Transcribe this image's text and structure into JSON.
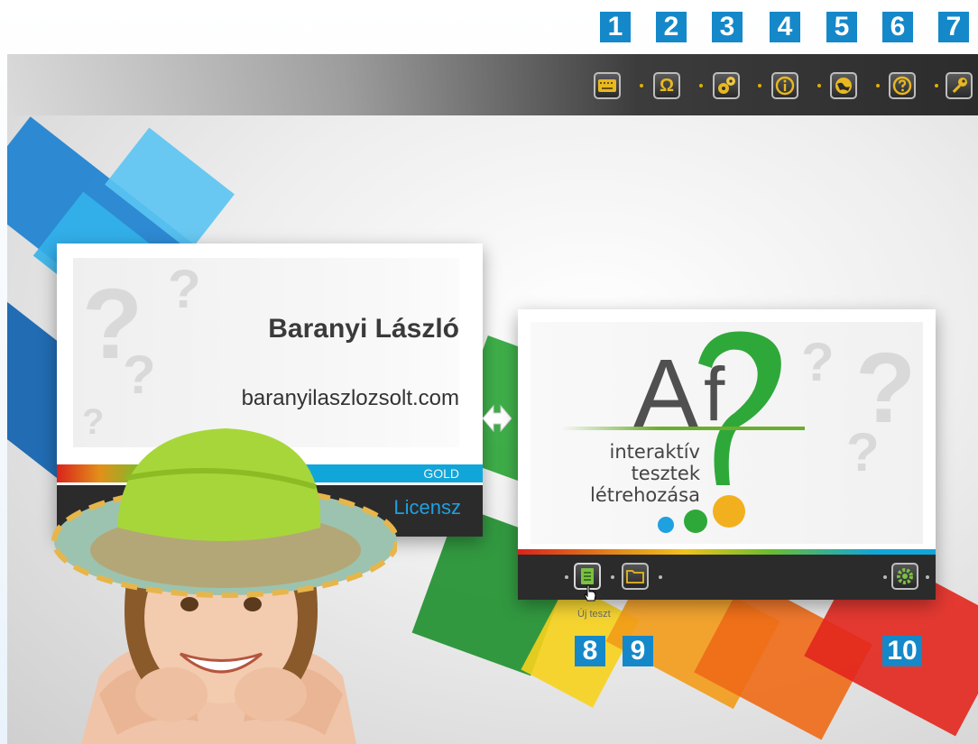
{
  "callouts": {
    "top": [
      "1",
      "2",
      "3",
      "4",
      "5",
      "6",
      "7"
    ],
    "bottom": [
      "8",
      "9",
      "10"
    ]
  },
  "toolbar": {
    "buttons": [
      {
        "name": "keyboard-icon"
      },
      {
        "name": "omega-icon",
        "glyph": "Ω"
      },
      {
        "name": "gears-icon"
      },
      {
        "name": "info-icon"
      },
      {
        "name": "globe-icon"
      },
      {
        "name": "help-icon"
      },
      {
        "name": "key-icon"
      }
    ],
    "accent": "#e0b000"
  },
  "license_card": {
    "name": "Baranyi László",
    "url": "baranyilaszlozsolt.com",
    "edition": "GOLD",
    "license_label": "Licensz",
    "license_color": "#1ea1df"
  },
  "logo_card": {
    "logo_big": "A",
    "logo_small": "f",
    "tagline": [
      "interaktív",
      "tesztek",
      "létrehozása"
    ],
    "dot_colors": [
      "#1ea1df",
      "#2fa83a",
      "#f2b01e"
    ],
    "footer_buttons": [
      {
        "name": "new-test-button",
        "icon": "new-document-icon"
      },
      {
        "name": "open-folder-button",
        "icon": "folder-icon"
      },
      {
        "name": "settings-button",
        "icon": "gear-icon"
      }
    ],
    "tooltip": "Új teszt"
  }
}
